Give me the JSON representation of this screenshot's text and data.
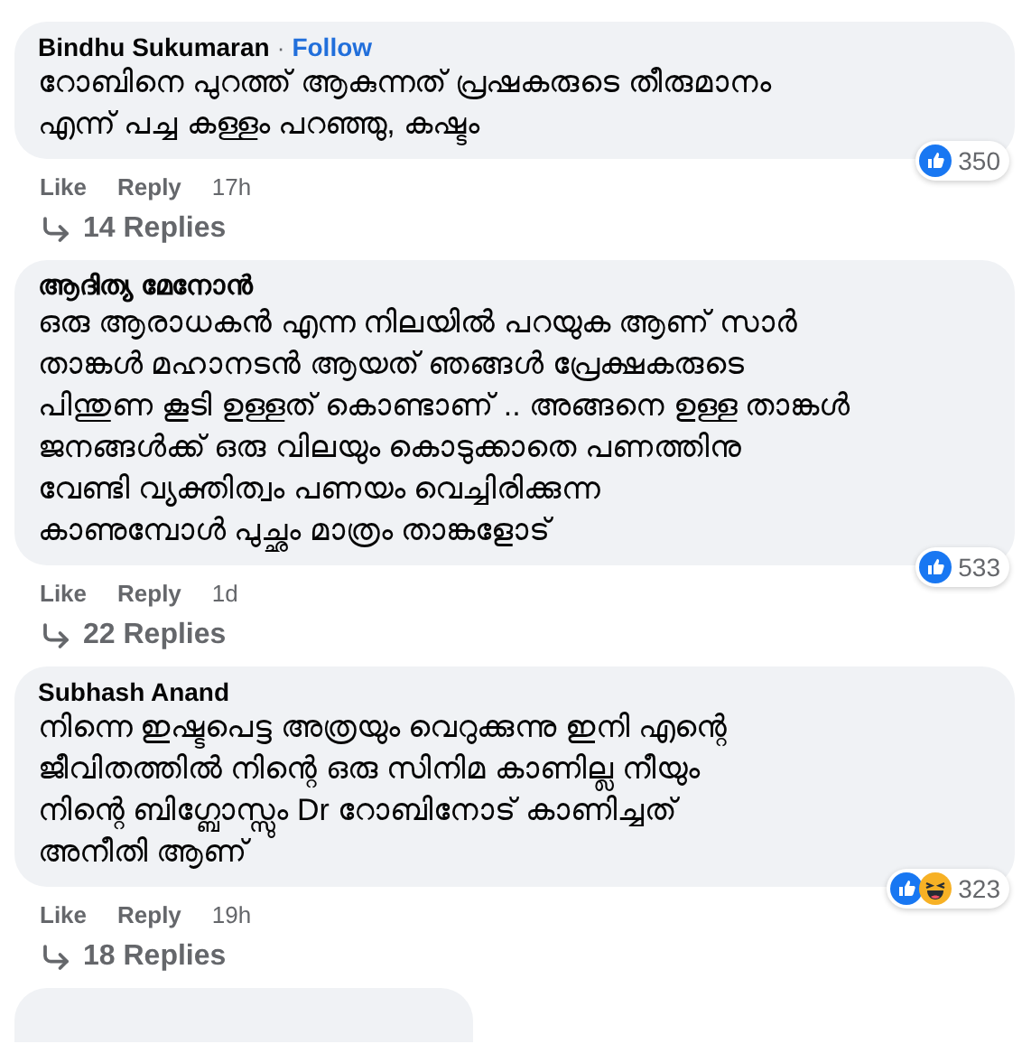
{
  "comments": [
    {
      "author": "Bindhu Sukumaran",
      "author_bold": false,
      "follow": {
        "separator": "·",
        "label": "Follow"
      },
      "lines": [
        "റോബിനെ പുറത്ത് ആകുന്നത് പ്രഷകരുടെ തീരുമാനം",
        "എന്ന് പച്ച കള്ളം പറഞ്ഞു, കഷ്ടം"
      ],
      "reactions": [
        {
          "kind": "like"
        }
      ],
      "reaction_count": "350",
      "actions": [
        "Like",
        "Reply"
      ],
      "time": "17h",
      "replies": "14 Replies"
    },
    {
      "author": "ആദിത്യ മേനോൻ",
      "author_bold": true,
      "lines": [
        "ഒരു ആരാധകൻ എന്ന നിലയിൽ പറയുക ആണ് സാർ",
        "താങ്കൾ മഹാനടൻ ആയത് ഞങ്ങൾ പ്രേക്ഷകരുടെ",
        "പിന്തുണ കൂടി ഉള്ളത് കൊണ്ടാണ് .. അങ്ങനെ ഉള്ള താങ്കൾ",
        "ജനങ്ങൾക്ക് ഒരു വിലയും കൊടുക്കാതെ പണത്തിനു",
        "വേണ്ടി വ്യക്തിത്വം പണയം വെച്ചിരിക്കുന്ന",
        "കാണുമ്പോൾ പുച്ഛം മാത്രം താങ്കളോട്"
      ],
      "reactions": [
        {
          "kind": "like"
        }
      ],
      "reaction_count": "533",
      "actions": [
        "Like",
        "Reply"
      ],
      "time": "1d",
      "replies": "22 Replies"
    },
    {
      "author": "Subhash Anand",
      "author_bold": false,
      "lines": [
        "നിന്നെ ഇഷ്ടപെട്ട അത്രയും വെറുക്കുന്നു ഇനി എന്റെ",
        "ജീവിതത്തിൽ നിന്റെ ഒരു സിനിമ കാണില്ല നീയും",
        "നിന്റെ ബിഗ്ബോസ്സും Dr റോബിനോട് കാണിച്ചത്",
        "അനീതി ആണ്"
      ],
      "reactions": [
        {
          "kind": "like"
        },
        {
          "kind": "haha"
        }
      ],
      "reaction_count": "323",
      "actions": [
        "Like",
        "Reply"
      ],
      "time": "19h",
      "replies": "18 Replies"
    }
  ],
  "next_comment": {
    "kind": "partial"
  }
}
